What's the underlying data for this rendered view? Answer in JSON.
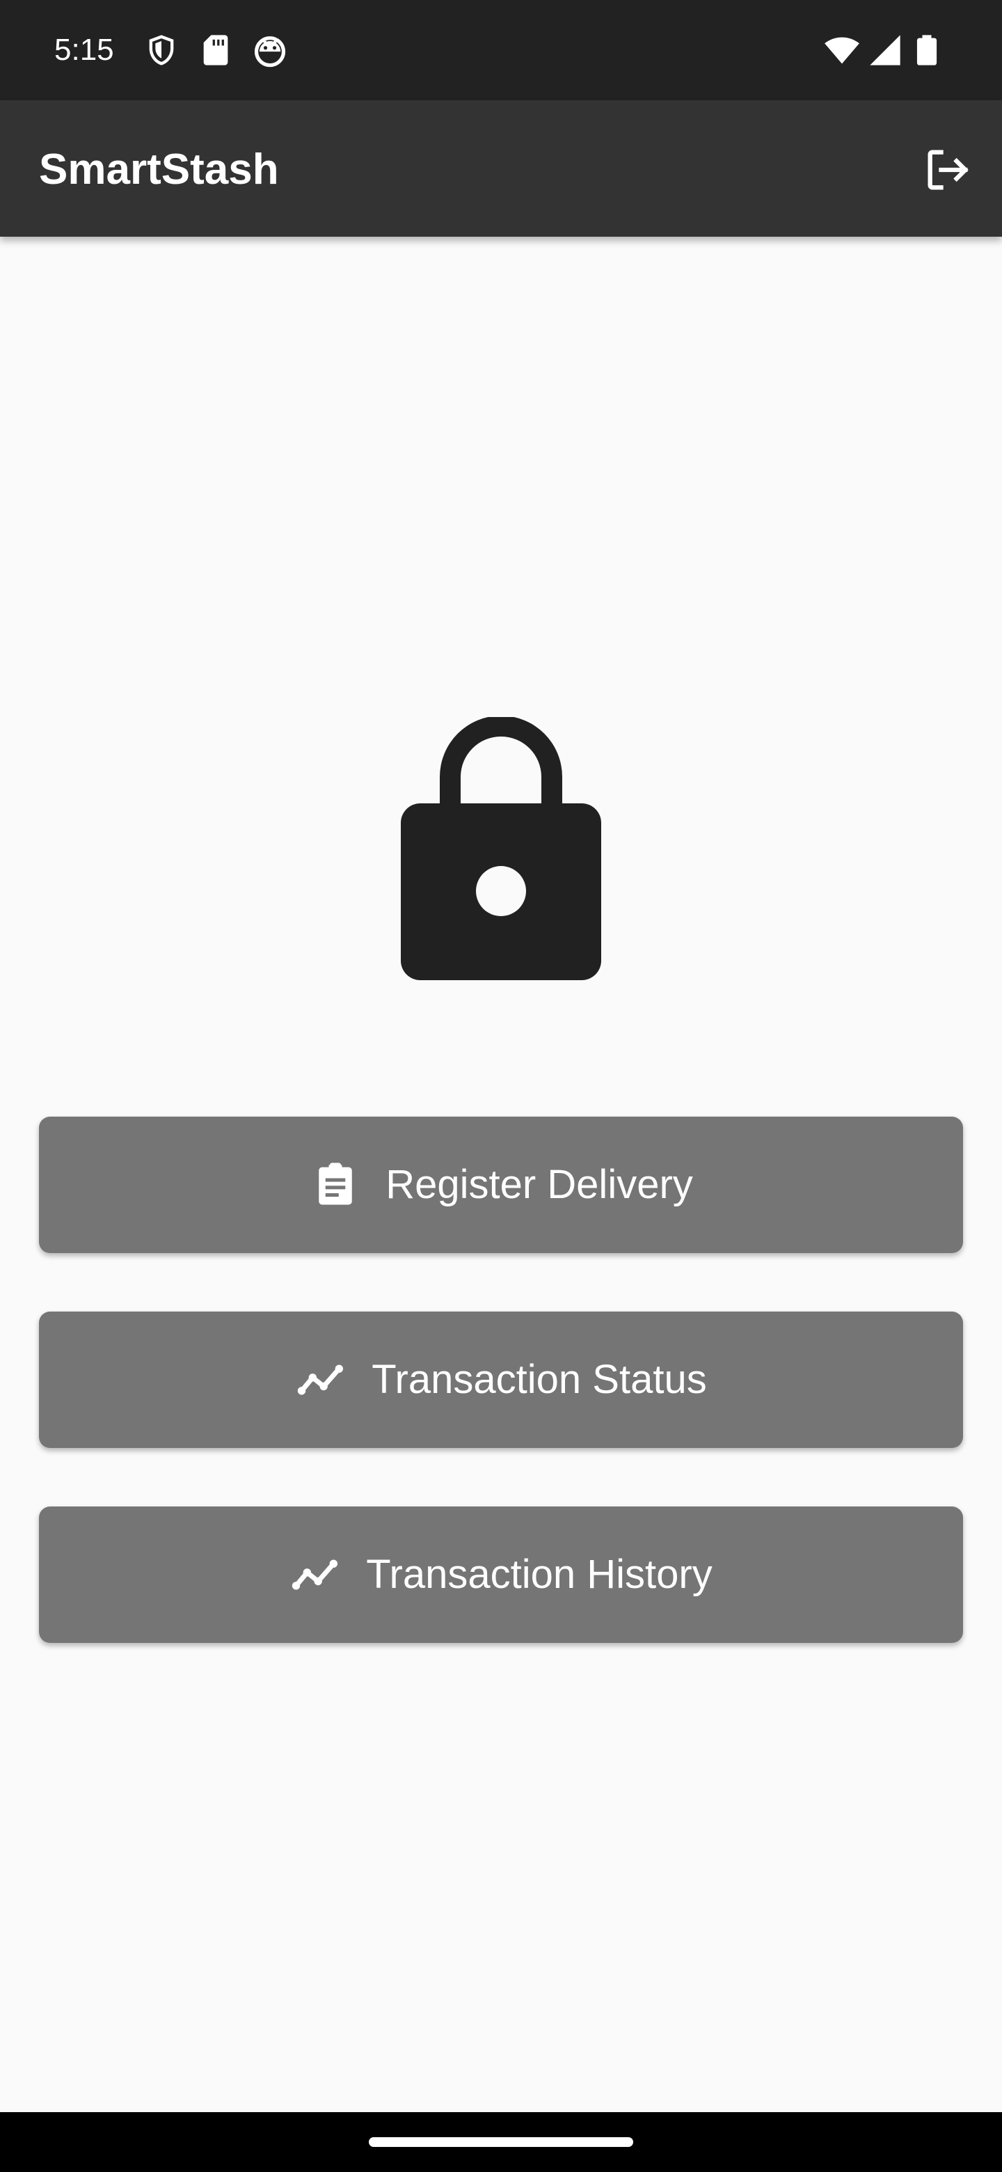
{
  "status_bar": {
    "time": "5:15",
    "left_icons": [
      "shield-icon",
      "sd-card-icon",
      "android-head-icon"
    ],
    "right_icons": [
      "wifi-icon",
      "cellular-signal-icon",
      "battery-icon"
    ]
  },
  "app_bar": {
    "title": "SmartStash",
    "action_icon": "logout-icon"
  },
  "main": {
    "hero_icon": "lock-icon",
    "buttons": [
      {
        "label": "Register Delivery",
        "icon": "clipboard-icon"
      },
      {
        "label": "Transaction Status",
        "icon": "trending-line-icon"
      },
      {
        "label": "Transaction History",
        "icon": "trending-line-icon"
      }
    ]
  },
  "colors": {
    "status_bar_bg": "#222222",
    "app_bar_bg": "#333333",
    "page_bg": "#fafafa",
    "button_bg": "#757575",
    "icon_dark": "#212121",
    "text_light": "#ffffff"
  }
}
